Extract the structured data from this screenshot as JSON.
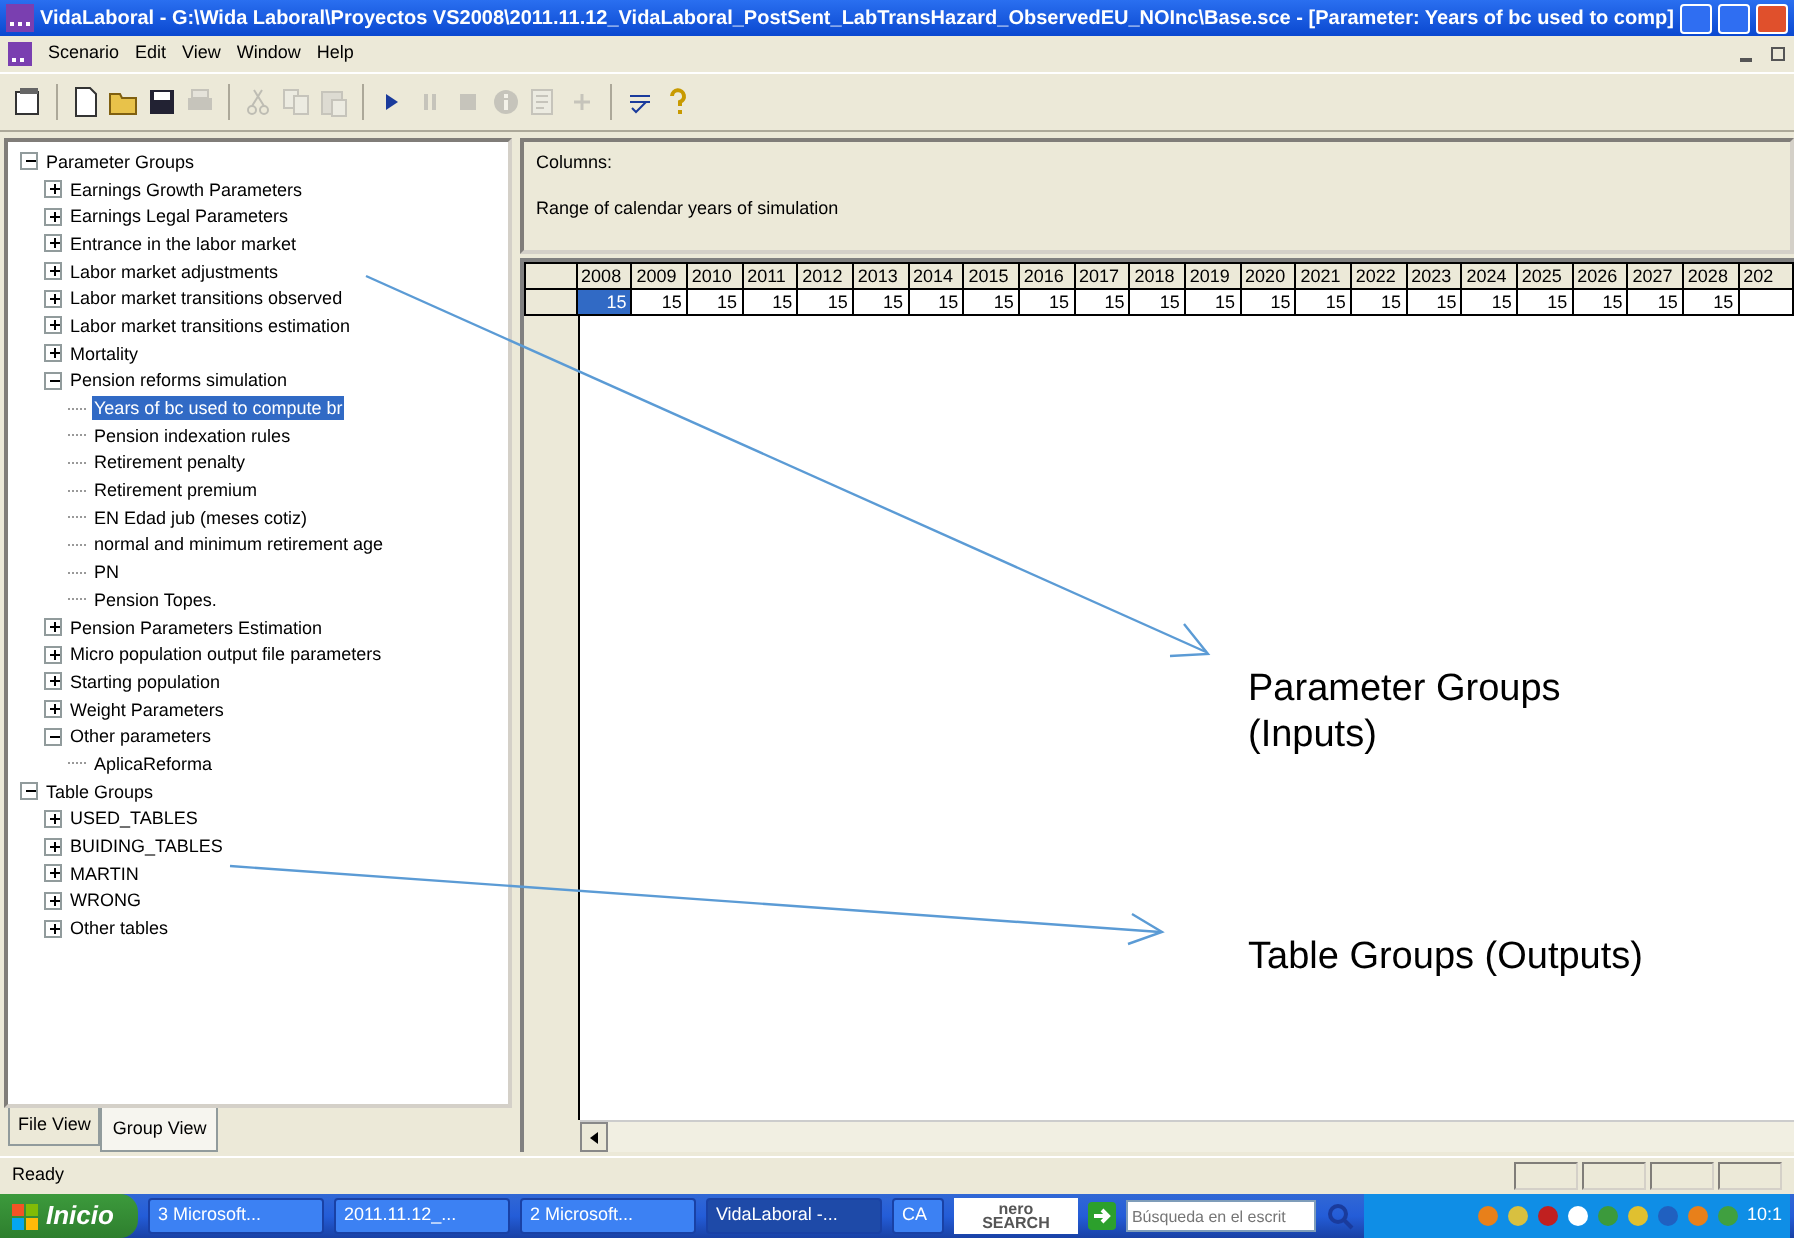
{
  "window": {
    "title": "VidaLaboral - G:\\Wida Laboral\\Proyectos VS2008\\2011.11.12_VidaLaboral_PostSent_LabTransHazard_ObservedEU_NOInc\\Base.sce - [Parameter: Years of bc used to comp]"
  },
  "menu": [
    "Scenario",
    "Edit",
    "View",
    "Window",
    "Help"
  ],
  "toolbar": [
    {
      "kind": "properties",
      "disabled": false
    },
    {
      "kind": "sep"
    },
    {
      "kind": "new",
      "disabled": false
    },
    {
      "kind": "open",
      "disabled": false
    },
    {
      "kind": "save",
      "disabled": false
    },
    {
      "kind": "print",
      "disabled": true
    },
    {
      "kind": "sep"
    },
    {
      "kind": "cut",
      "disabled": true
    },
    {
      "kind": "copy",
      "disabled": true
    },
    {
      "kind": "paste",
      "disabled": true
    },
    {
      "kind": "sep"
    },
    {
      "kind": "run",
      "disabled": false
    },
    {
      "kind": "pause",
      "disabled": true
    },
    {
      "kind": "stop",
      "disabled": true
    },
    {
      "kind": "info",
      "disabled": true
    },
    {
      "kind": "report",
      "disabled": true
    },
    {
      "kind": "add",
      "disabled": true
    },
    {
      "kind": "sep"
    },
    {
      "kind": "spell",
      "disabled": false
    },
    {
      "kind": "help",
      "disabled": false
    }
  ],
  "tree": [
    {
      "label": "Parameter Groups",
      "kind": "group",
      "expanded": true,
      "selected": false,
      "children": [
        {
          "label": "Earnings Growth Parameters",
          "kind": "group",
          "expanded": false,
          "selected": false
        },
        {
          "label": "Earnings Legal Parameters",
          "kind": "group",
          "expanded": false,
          "selected": false
        },
        {
          "label": "Entrance in the labor market",
          "kind": "group",
          "expanded": false,
          "selected": false
        },
        {
          "label": "Labor market adjustments",
          "kind": "group",
          "expanded": false,
          "selected": false
        },
        {
          "label": "Labor market transitions observed",
          "kind": "group",
          "expanded": false,
          "selected": false
        },
        {
          "label": "Labor market transitions estimation",
          "kind": "group",
          "expanded": false,
          "selected": false
        },
        {
          "label": "Mortality",
          "kind": "group",
          "expanded": false,
          "selected": false
        },
        {
          "label": "Pension reforms simulation",
          "kind": "group",
          "expanded": true,
          "selected": false,
          "children": [
            {
              "label": "Years of bc used to compute br",
              "kind": "leaf",
              "selected": true
            },
            {
              "label": "Pension indexation rules",
              "kind": "leaf",
              "selected": false
            },
            {
              "label": "Retirement penalty",
              "kind": "leaf",
              "selected": false
            },
            {
              "label": "Retirement premium",
              "kind": "leaf",
              "selected": false
            },
            {
              "label": "EN Edad jub (meses cotiz)",
              "kind": "leaf",
              "selected": false
            },
            {
              "label": "normal and minimum retirement age",
              "kind": "leaf",
              "selected": false
            },
            {
              "label": "PN",
              "kind": "leaf",
              "selected": false
            },
            {
              "label": "Pension Topes.",
              "kind": "leaf",
              "selected": false
            }
          ]
        },
        {
          "label": "Pension Parameters Estimation",
          "kind": "group",
          "expanded": false,
          "selected": false
        },
        {
          "label": "Micro population output file parameters",
          "kind": "group",
          "expanded": false,
          "selected": false
        },
        {
          "label": "Starting population",
          "kind": "group",
          "expanded": false,
          "selected": false
        },
        {
          "label": "Weight Parameters",
          "kind": "group",
          "expanded": false,
          "selected": false
        },
        {
          "label": "Other parameters",
          "kind": "group",
          "expanded": true,
          "selected": false,
          "children": [
            {
              "label": "AplicaReforma",
              "kind": "leaf",
              "selected": false
            }
          ]
        }
      ]
    },
    {
      "label": "Table Groups",
      "kind": "group",
      "expanded": true,
      "selected": false,
      "children": [
        {
          "label": "USED_TABLES",
          "kind": "group",
          "expanded": false,
          "selected": false
        },
        {
          "label": "BUIDING_TABLES",
          "kind": "group",
          "expanded": false,
          "selected": false
        },
        {
          "label": "MARTIN",
          "kind": "group",
          "expanded": false,
          "selected": false
        },
        {
          "label": "WRONG",
          "kind": "group",
          "expanded": false,
          "selected": false
        },
        {
          "label": "Other tables",
          "kind": "group",
          "expanded": false,
          "selected": false
        }
      ]
    }
  ],
  "tabs": [
    {
      "label": "File View",
      "selected": false
    },
    {
      "label": "Group View",
      "selected": true
    }
  ],
  "info": {
    "heading": "Columns:",
    "description": "Range of calendar years of simulation"
  },
  "grid": {
    "columns": [
      "2008",
      "2009",
      "2010",
      "2011",
      "2012",
      "2013",
      "2014",
      "2015",
      "2016",
      "2017",
      "2018",
      "2019",
      "2020",
      "2021",
      "2022",
      "2023",
      "2024",
      "2025",
      "2026",
      "2027",
      "2028",
      "202"
    ],
    "cells": [
      {
        "value": "15",
        "selected": true
      },
      {
        "value": "15",
        "selected": false
      },
      {
        "value": "15",
        "selected": false
      },
      {
        "value": "15",
        "selected": false
      },
      {
        "value": "15",
        "selected": false
      },
      {
        "value": "15",
        "selected": false
      },
      {
        "value": "15",
        "selected": false
      },
      {
        "value": "15",
        "selected": false
      },
      {
        "value": "15",
        "selected": false
      },
      {
        "value": "15",
        "selected": false
      },
      {
        "value": "15",
        "selected": false
      },
      {
        "value": "15",
        "selected": false
      },
      {
        "value": "15",
        "selected": false
      },
      {
        "value": "15",
        "selected": false
      },
      {
        "value": "15",
        "selected": false
      },
      {
        "value": "15",
        "selected": false
      },
      {
        "value": "15",
        "selected": false
      },
      {
        "value": "15",
        "selected": false
      },
      {
        "value": "15",
        "selected": false
      },
      {
        "value": "15",
        "selected": false
      },
      {
        "value": "15",
        "selected": false
      }
    ]
  },
  "status_bar": "Ready",
  "taskbar": {
    "start": "Inicio",
    "buttons": [
      {
        "label": "3 Microsoft...",
        "selected": false
      },
      {
        "label": "2011.11.12_...",
        "selected": false
      },
      {
        "label": "2 Microsoft...",
        "selected": false
      },
      {
        "label": "VidaLaboral -...",
        "selected": true
      },
      {
        "label": "CA",
        "selected": false
      }
    ],
    "search_logo": [
      "nero",
      "SEARCH"
    ],
    "search": {
      "placeholder": "Búsqueda en el escrit"
    },
    "clock": "10:1"
  },
  "annotations": [
    {
      "label": "Parameter Groups (Inputs)"
    },
    {
      "label": "Table Groups (Outputs)"
    }
  ]
}
